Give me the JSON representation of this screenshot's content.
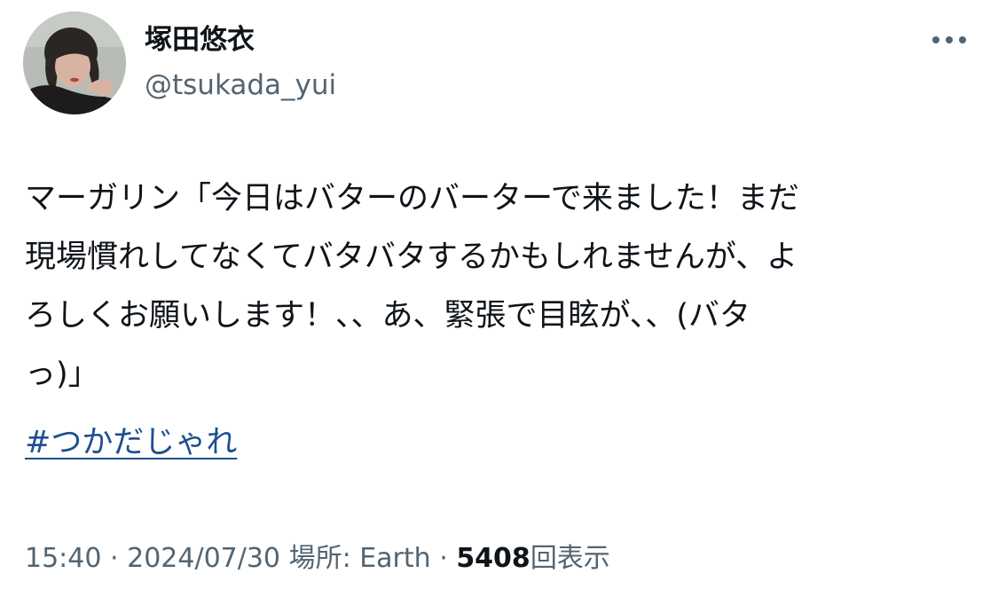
{
  "author": {
    "display_name": "塚田悠衣",
    "handle": "@tsukada_yui"
  },
  "more_icon": "more-horizontal-icon",
  "tweet": {
    "lines": [
      "マーガリン「今日はバターのバーターで来ました！まだ",
      "現場慣れしてなくてバタバタするかもしれませんが、よ",
      "ろしくお願いします！、、あ、緊張で目眩が、、(バタ",
      "っ)」"
    ],
    "hashtag": "#つかだじゃれ"
  },
  "meta": {
    "time": "15:40",
    "separator": "·",
    "date": "2024/07/30",
    "location_label": "場所: Earth",
    "views_count": "5408",
    "views_label": "回表示"
  },
  "colors": {
    "text_primary": "#0f1419",
    "text_secondary": "#536471",
    "hashtag": "#1d4f91"
  }
}
